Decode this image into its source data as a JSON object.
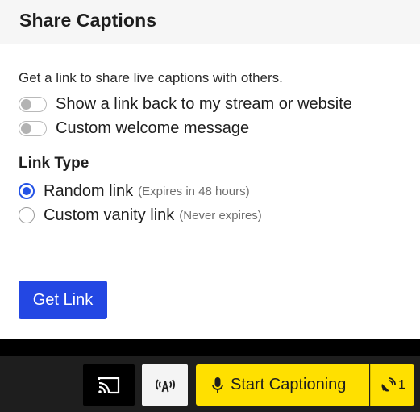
{
  "dialog": {
    "title": "Share Captions",
    "description": "Get a link to share live captions with others.",
    "toggles": [
      {
        "label": "Show a link back to my stream or website",
        "enabled": false
      },
      {
        "label": "Custom welcome message",
        "enabled": false
      }
    ],
    "link_type": {
      "title": "Link Type",
      "options": [
        {
          "label": "Random link",
          "note": "(Expires in 48 hours)",
          "selected": true
        },
        {
          "label": "Custom vanity link",
          "note": "(Never expires)",
          "selected": false
        }
      ]
    },
    "get_link_label": "Get Link"
  },
  "bottom_bar": {
    "cast_icon": "cast-icon",
    "caption_icon_text": "(A)",
    "start_captioning_label": "Start Captioning",
    "listeners_count": "1"
  },
  "colors": {
    "accent_blue": "#2347e3",
    "yellow": "#ffe000",
    "bar_background": "#1e1e1e"
  }
}
